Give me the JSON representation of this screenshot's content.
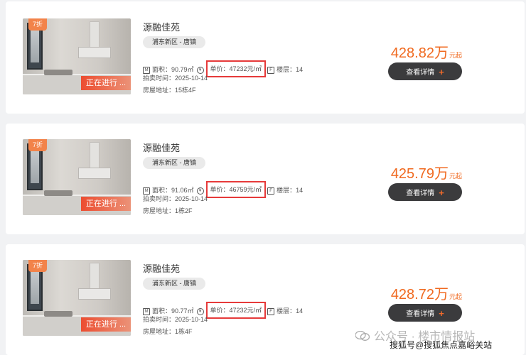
{
  "listings": [
    {
      "discount": "7折",
      "status": "正在进行 ...",
      "name": "源融佳苑",
      "district": "浦东新区 - 唐镇",
      "area": "面积：90.79㎡",
      "unit_price": "单价：47232元/㎡",
      "floor": "楼层：14",
      "auction_time": "拍卖时间：2025-10-14",
      "address": "房屋地址：15栋4F",
      "price": "428.82万",
      "price_suffix": "元起",
      "button_label": "查看详情"
    },
    {
      "discount": "7折",
      "status": "正在进行 ...",
      "name": "源融佳苑",
      "district": "浦东新区 - 唐镇",
      "area": "面积：91.06㎡",
      "unit_price": "单价：46759元/㎡",
      "floor": "楼层：14",
      "auction_time": "拍卖时间：2025-10-14",
      "address": "房屋地址：1栋2F",
      "price": "425.79万",
      "price_suffix": "元起",
      "button_label": "查看详情"
    },
    {
      "discount": "7折",
      "status": "正在进行 ...",
      "name": "源融佳苑",
      "district": "浦东新区 - 唐镇",
      "area": "面积：90.77㎡",
      "unit_price": "单价：47232元/㎡",
      "floor": "楼层：14",
      "auction_time": "拍卖时间：2025-10-14",
      "address": "房屋地址：1栋4F",
      "price": "428.72万",
      "price_suffix": "元起",
      "button_label": "查看详情"
    }
  ],
  "watermark": {
    "line1": "公众号 · 楼市情报站",
    "line2": "搜狐号@搜狐焦点嘉峪关站"
  },
  "colors": {
    "price": "#f06a20",
    "button": "#3b3b3d",
    "highlight_box": "#e63a3a",
    "discount_tag": "#f2834a"
  }
}
